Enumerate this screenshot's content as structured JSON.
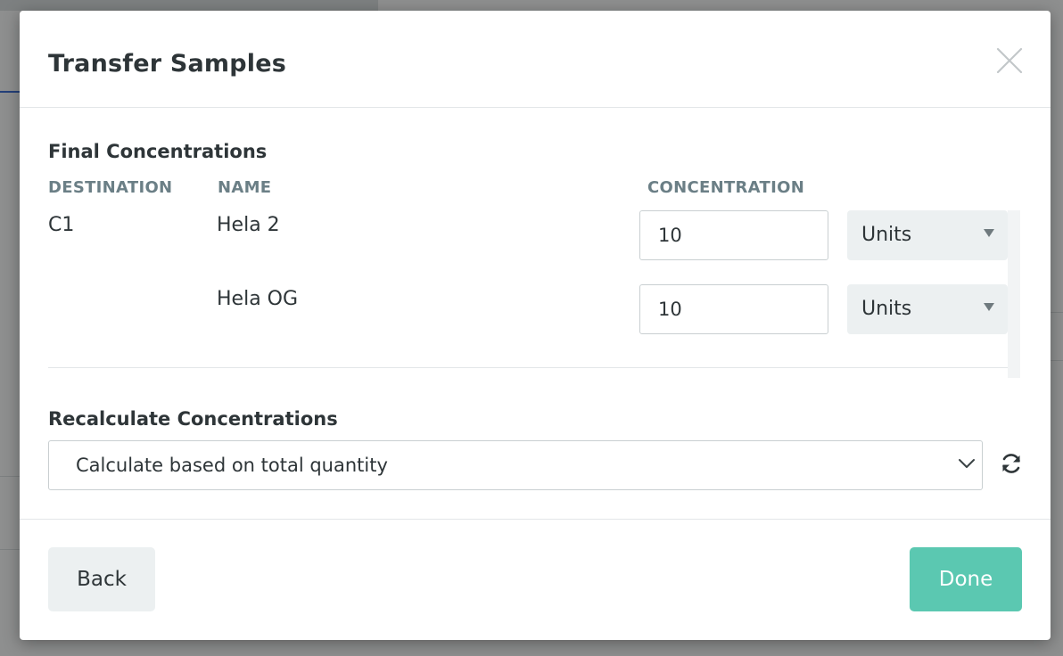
{
  "modal": {
    "title": "Transfer Samples",
    "final_concentrations": {
      "heading": "Final Concentrations",
      "columns": {
        "destination": "DESTINATION",
        "name": "NAME",
        "concentration": "CONCENTRATION"
      },
      "rows": [
        {
          "destination": "C1",
          "name": "Hela 2",
          "concentration": "10",
          "unit": "Units"
        },
        {
          "destination": "",
          "name": "Hela OG",
          "concentration": "10",
          "unit": "Units"
        }
      ]
    },
    "recalculate": {
      "heading": "Recalculate Concentrations",
      "selected": "Calculate based on total quantity"
    },
    "footer": {
      "back_label": "Back",
      "done_label": "Done"
    }
  },
  "icons": {
    "close": "close-icon",
    "refresh": "refresh-icon",
    "chevron": "chevron-down-icon",
    "caret": "caret-down-icon"
  },
  "colors": {
    "primary": "#5bc8b1",
    "secondary_bg": "#ecf0f1",
    "text": "#2e3538",
    "column_header": "#6b7f86"
  }
}
